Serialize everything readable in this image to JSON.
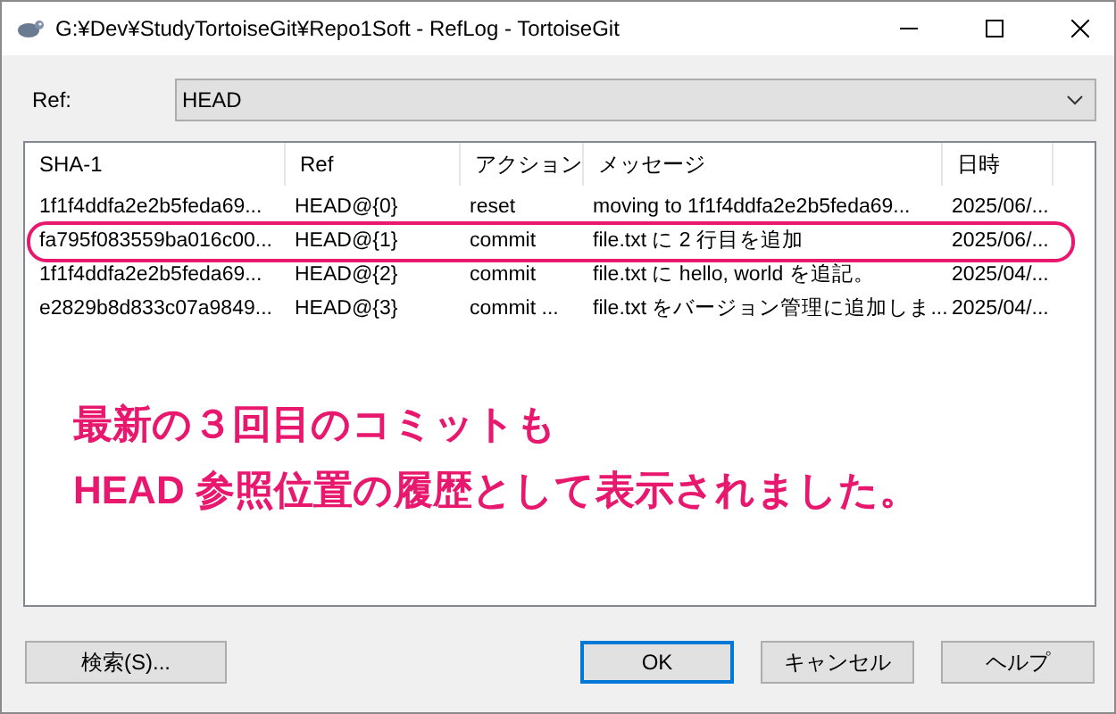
{
  "window": {
    "title": "G:¥Dev¥StudyTortoiseGit¥Repo1Soft - RefLog - TortoiseGit"
  },
  "ref": {
    "label": "Ref:",
    "value": "HEAD"
  },
  "table": {
    "columns": [
      "SHA-1",
      "Ref",
      "アクション",
      "メッセージ",
      "日時"
    ],
    "rows": [
      {
        "cells": [
          "1f1f4ddfa2e2b5feda69...",
          "HEAD@{0}",
          "reset",
          "moving to 1f1f4ddfa2e2b5feda69...",
          "2025/06/..."
        ],
        "highlighted": false
      },
      {
        "cells": [
          "fa795f083559ba016c00...",
          "HEAD@{1}",
          "commit",
          "file.txt に 2 行目を追加",
          "2025/06/..."
        ],
        "highlighted": true
      },
      {
        "cells": [
          "1f1f4ddfa2e2b5feda69...",
          "HEAD@{2}",
          "commit",
          "file.txt に hello, world を追記。",
          "2025/04/..."
        ],
        "highlighted": false
      },
      {
        "cells": [
          "e2829b8d833c07a9849...",
          "HEAD@{3}",
          "commit ...",
          "file.txt をバージョン管理に追加しま...",
          "2025/04/..."
        ],
        "highlighted": false
      }
    ]
  },
  "annotation": {
    "lines": [
      "最新の３回目のコミットも",
      "HEAD 参照位置の履歴として表示されました。"
    ]
  },
  "buttons": [
    {
      "label": "検索(S)...",
      "kind": "left"
    },
    {
      "label": "OK",
      "kind": "default"
    },
    {
      "label": "キャンセル",
      "kind": "normal"
    },
    {
      "label": "ヘルプ",
      "kind": "normal"
    }
  ]
}
